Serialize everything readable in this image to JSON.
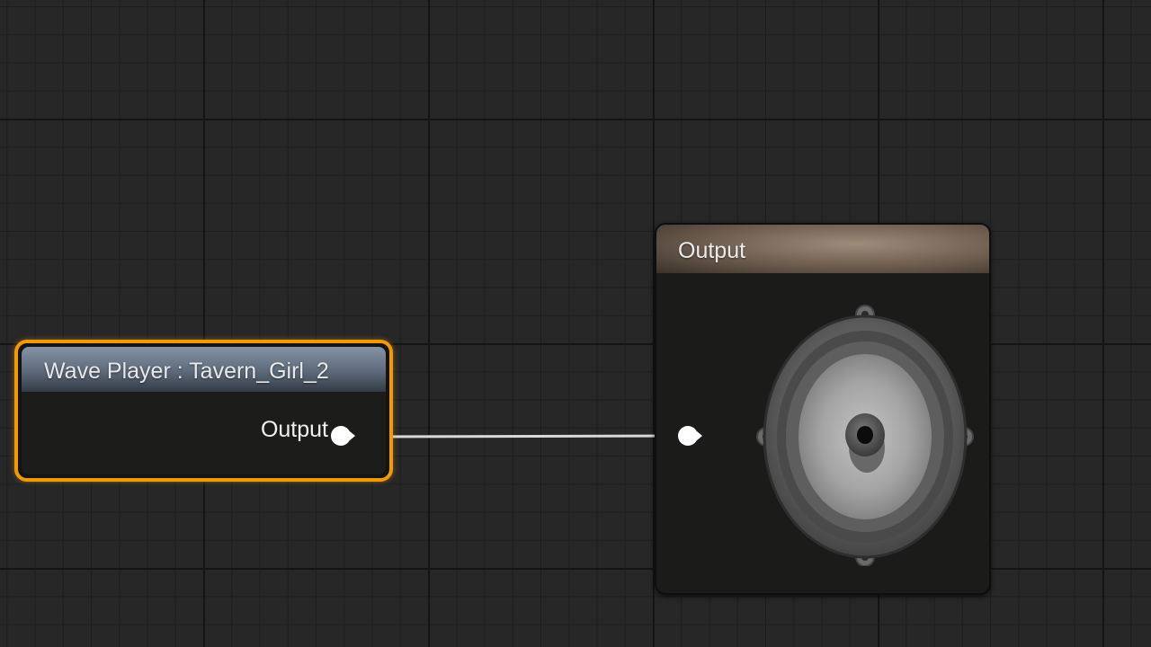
{
  "graph": {
    "nodes": {
      "wave_player": {
        "title": "Wave Player : Tavern_Girl_2",
        "output_pin_label": "Output",
        "selected": true,
        "header_color": "#6f7d8f",
        "selection_color": "#f09a0b"
      },
      "output": {
        "title": "Output",
        "header_color": "#8a7867",
        "icon": "speaker-icon"
      }
    },
    "connection": {
      "from": "wave_player.output",
      "to": "output.input",
      "wire_color": "#d9d9d9"
    },
    "pin_color": "#ffffff"
  }
}
